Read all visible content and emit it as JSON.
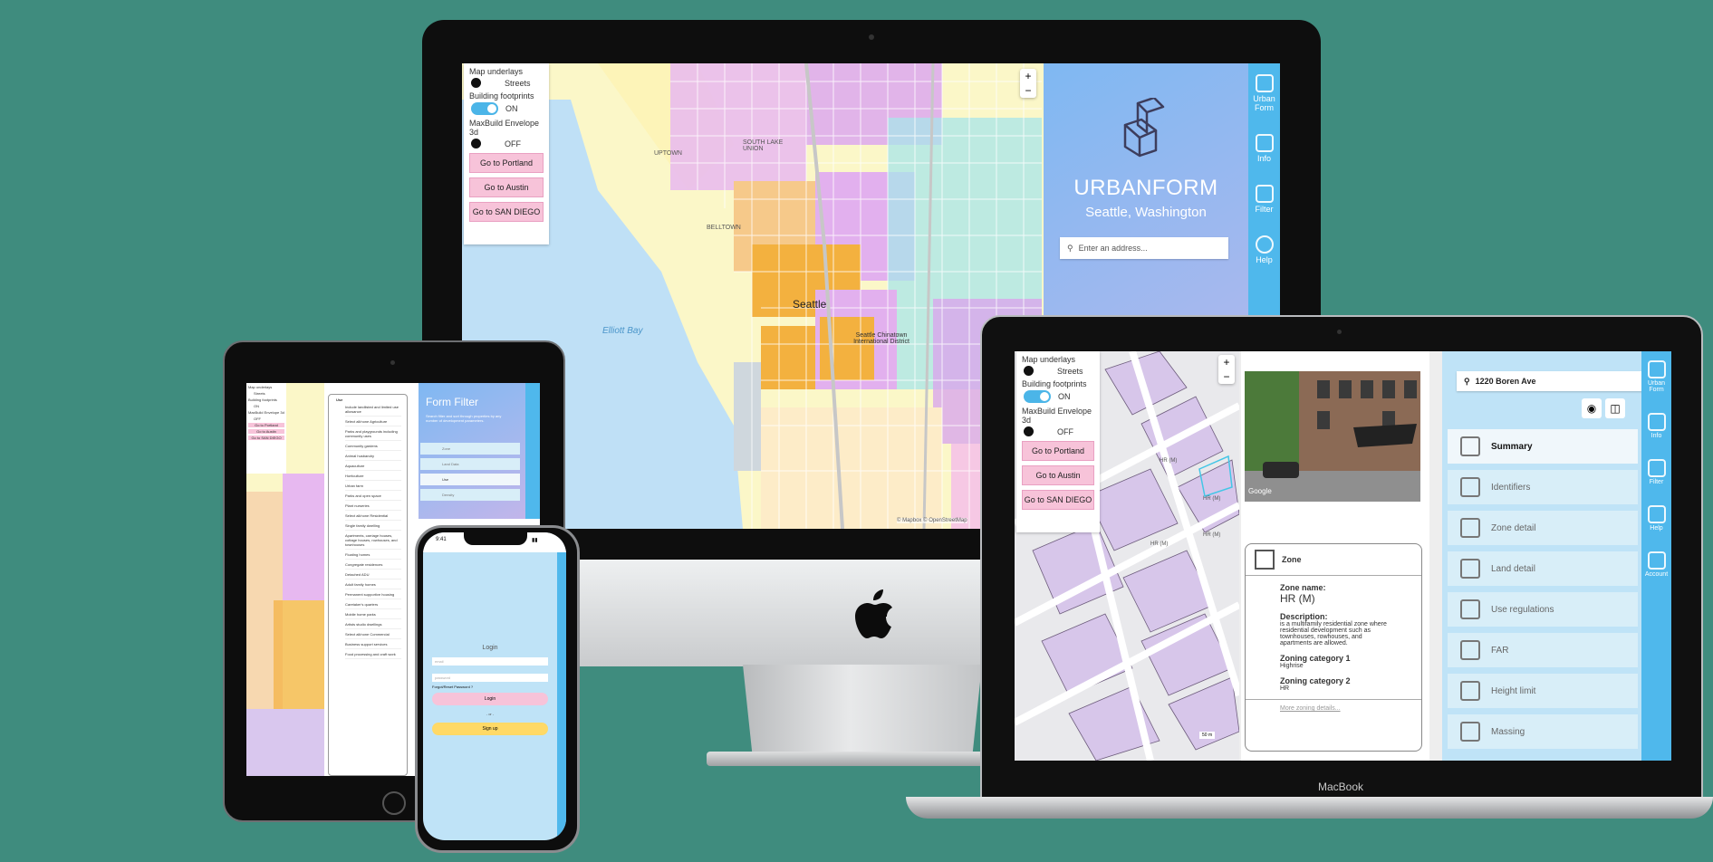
{
  "map_controls": {
    "underlays_label": "Map underlays",
    "streets_label": "Streets",
    "footprints_label": "Building footprints",
    "footprints_state": "ON",
    "envelope_label": "MaxBuild Envelope 3d",
    "envelope_state": "OFF",
    "btn_portland": "Go to Portland",
    "btn_austin": "Go to Austin",
    "btn_sandiego": "Go to SAN DIEGO",
    "zoom_in": "+",
    "zoom_out": "−"
  },
  "brand": {
    "title": "URBANFORM",
    "subtitle": "Seattle, Washington",
    "address_placeholder": "Enter an address..."
  },
  "map_labels": {
    "elliott_bay": "Elliott Bay",
    "seattle": "Seattle",
    "district": "Seattle Chinatown International District",
    "belltown": "BELLTOWN",
    "south_lake_union": "SOUTH LAKE UNION",
    "uptown": "UPTOWN",
    "attribution": "© Mapbox © OpenStreetMap"
  },
  "nav": [
    {
      "label": "Urban Form",
      "icon": "urbanform-logo-icon"
    },
    {
      "label": "Info",
      "icon": "info-icon"
    },
    {
      "label": "Filter",
      "icon": "filter-icon"
    },
    {
      "label": "Help",
      "icon": "help-icon"
    }
  ],
  "macbook": {
    "brand": "MacBook",
    "address_value": "1220 Boren Ave",
    "google_label": "Google",
    "zone_card": {
      "title": "Zone",
      "zone_name_label": "Zone name:",
      "zone_name": "HR (M)",
      "description_label": "Description:",
      "description": "is a multifamily residential zone where residential development such as townhouses, rowhouses, and apartments are allowed.",
      "cat1_label": "Zoning category 1",
      "cat1": "Highrise",
      "cat2_label": "Zoning category 2",
      "cat2": "HR",
      "more_link": "More zoning details..."
    },
    "menu": [
      {
        "label": "Summary",
        "icon": "summary-list-icon"
      },
      {
        "label": "Identifiers",
        "icon": "hashtag-icon"
      },
      {
        "label": "Zone detail",
        "icon": "zone-detail-icon"
      },
      {
        "label": "Land detail",
        "icon": "crop-icon"
      },
      {
        "label": "Use regulations",
        "icon": "gear-icon"
      },
      {
        "label": "FAR",
        "icon": "layers-icon"
      },
      {
        "label": "Height limit",
        "icon": "height-icon"
      },
      {
        "label": "Massing",
        "icon": "massing-icon"
      }
    ],
    "rail": [
      "Urban Form",
      "Info",
      "Filter",
      "Help",
      "Account"
    ],
    "parcel_labels": [
      "HR (M)",
      "HR (M)",
      "HR (M)",
      "HR (M)"
    ],
    "scale_label": "50 m"
  },
  "ipad": {
    "panel_title": "Form Filter",
    "panel_desc": "Search filter and sort through properties by any number of development parameters.",
    "filter_items": [
      "Zone",
      "Land Data",
      "Use",
      "Density"
    ],
    "use_list_title": "Use",
    "use_list": [
      "Include landlisted and limited use allowance",
      "Select all/none Agriculture",
      "Parks and playgrounds including community uses",
      "Community gardens",
      "Animal husbandry",
      "Aquaculture",
      "Horticulture",
      "Urban farm",
      "Parks and open space",
      "Plant nurseries",
      "Select all/none Residential",
      "Single family dwelling",
      "Apartments, carriage houses, cottage houses, rowhouses, and townhouses",
      "Floating homes",
      "Congregate residences",
      "Detached ADU",
      "Adult family homes",
      "Permanent supportive housing",
      "Caretaker's quarters",
      "Mobile home parks",
      "Artists studio dwellings",
      "Select all/none Commercial",
      "Business support services",
      "Food processing and craft work"
    ]
  },
  "iphone": {
    "time": "9:41",
    "login_title": "Login",
    "email_placeholder": "email",
    "password_placeholder": "password",
    "forgot": "Forgot/Reset Password ?",
    "login_btn": "Login",
    "or": "- or -",
    "signup_btn": "Sign up"
  },
  "colors": {
    "background": "#3f8c7e",
    "accent_blue": "#4fb8ec",
    "pink_button": "#f7c3d9",
    "signup_yellow": "#ffd966",
    "zone_purple": "#d9a6ec",
    "zone_orange": "#f3b13f",
    "zone_yellow": "#fbf7c8"
  }
}
